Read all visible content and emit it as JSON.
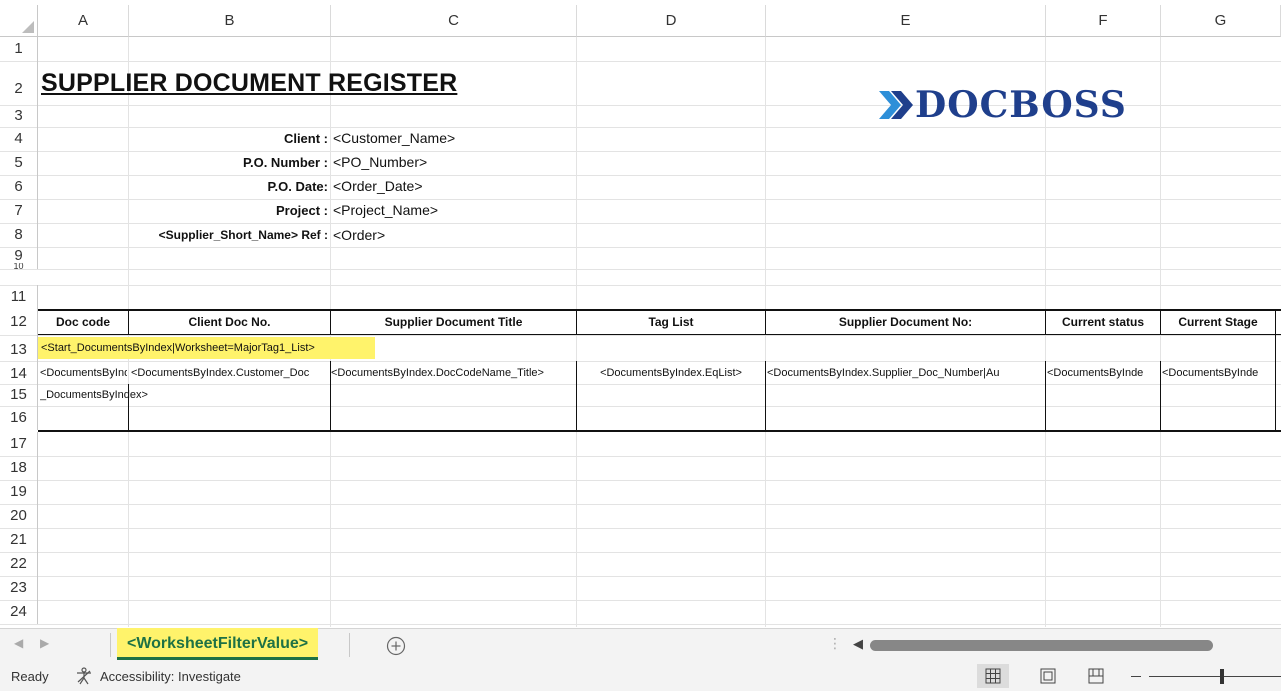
{
  "columns": [
    "A",
    "B",
    "C",
    "D",
    "E",
    "F",
    "G"
  ],
  "rows": [
    "1",
    "2",
    "3",
    "4",
    "5",
    "6",
    "7",
    "8",
    "9",
    "10",
    "11",
    "12",
    "13",
    "14",
    "15",
    "16",
    "17",
    "18",
    "19",
    "20",
    "21",
    "22",
    "23",
    "24"
  ],
  "sheet": {
    "title": "SUPPLIER DOCUMENT REGISTER",
    "logo_text": "DOCBOSS",
    "info": [
      {
        "label": "Client :",
        "value": "<Customer_Name>"
      },
      {
        "label": "P.O. Number :",
        "value": "<PO_Number>"
      },
      {
        "label": "P.O. Date:",
        "value": "<Order_Date>"
      },
      {
        "label": "Project :",
        "value": "<Project_Name>"
      },
      {
        "label": "<Supplier_Short_Name> Ref :",
        "value": "<Order>"
      }
    ],
    "table_headers": [
      "Doc code",
      "Client Doc No.",
      "Supplier Document Title",
      "Tag List",
      "Supplier Document No:",
      "Current status",
      "Current Stage"
    ],
    "row13": "<Start_DocumentsByIndex|Worksheet=MajorTag1_List>",
    "row14": [
      "<DocumentsByIndex.Doc",
      "<DocumentsByIndex.Customer_Doc",
      "<DocumentsByIndex.DocCodeName_Title>",
      "<DocumentsByIndex.EqList>",
      "<DocumentsByIndex.Supplier_Doc_Number|Au",
      "<DocumentsByInde",
      "<DocumentsByInde"
    ],
    "row15": "_DocumentsByIndex>"
  },
  "tabs": {
    "active_sheet": "<WorksheetFilterValue>",
    "add_sheet_icon": "plus-circle-icon"
  },
  "status": {
    "ready": "Ready",
    "accessibility": "Accessibility: Investigate"
  },
  "colors": {
    "highlight": "#fff36b",
    "tab_green": "#1e7145",
    "logo_blue": "#1f3f8c",
    "logo_light": "#2e8fd8"
  }
}
